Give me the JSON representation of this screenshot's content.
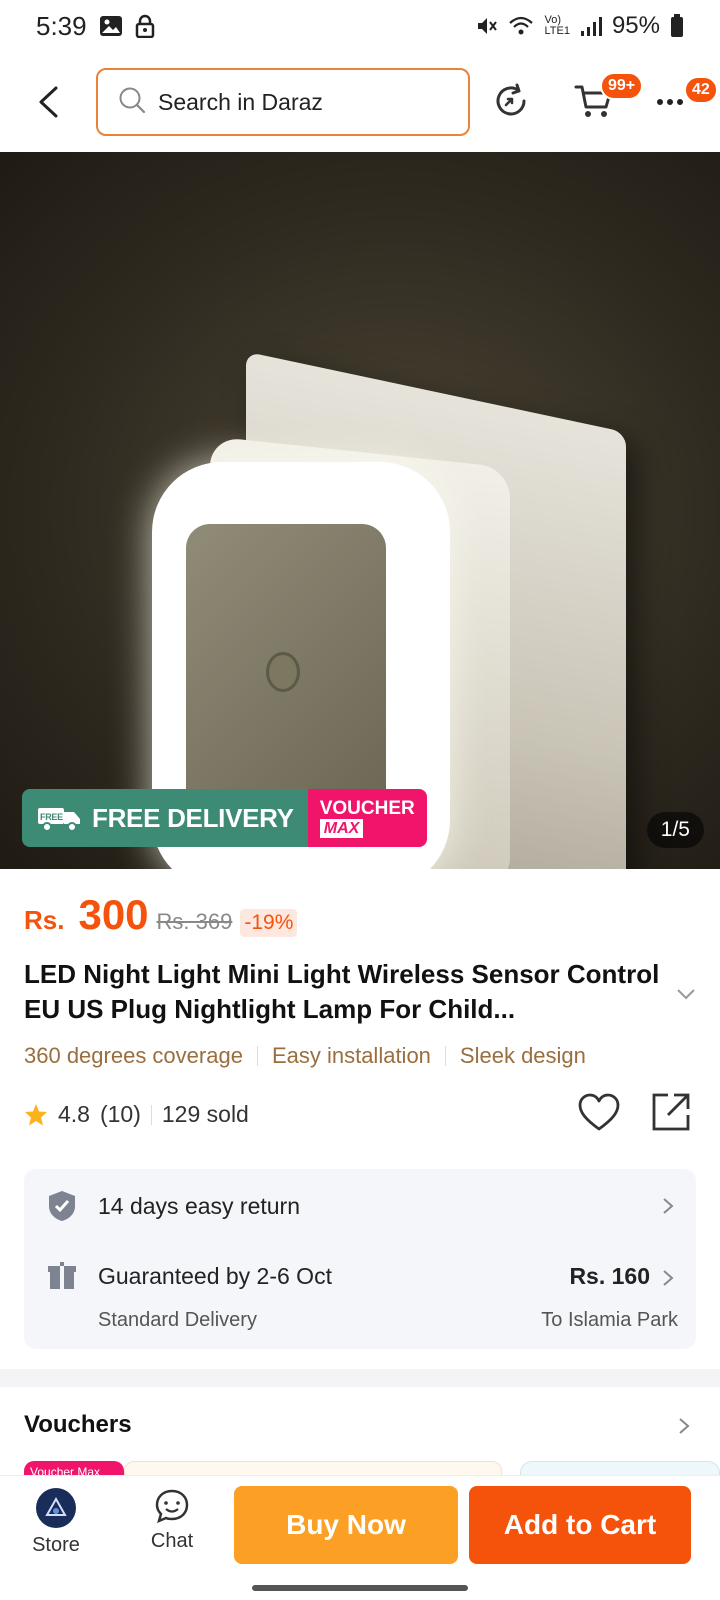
{
  "status_bar": {
    "time": "5:39",
    "battery": "95%"
  },
  "header": {
    "search_placeholder": "Search in Daraz",
    "cart_badge": "99+",
    "more_badge": "42"
  },
  "gallery": {
    "promo_free_tag": "FREE",
    "promo_free_label": "FREE DELIVERY",
    "promo_voucher_line1": "VOUCHER",
    "promo_voucher_line2": "MAX",
    "counter": "1/5"
  },
  "product": {
    "currency": "Rs.",
    "price": "300",
    "original_price": "Rs. 369",
    "discount": "-19%",
    "title": "LED Night Light Mini Light Wireless Sensor Control EU US Plug Nightlight Lamp For Child...",
    "features": [
      "360 degrees coverage",
      "Easy installation",
      "Sleek design"
    ],
    "rating": "4.8",
    "rating_count": "(10)",
    "sold": "129 sold"
  },
  "delivery": {
    "return_policy": "14 days easy return",
    "guarantee": "Guaranteed by 2-6 Oct",
    "method": "Standard Delivery",
    "fee": "Rs. 160",
    "location": "To Islamia Park"
  },
  "vouchers": {
    "title": "Vouchers",
    "peek_label": "Voucher Max"
  },
  "bottom_bar": {
    "store_label": "Store",
    "chat_label": "Chat",
    "buy_now": "Buy Now",
    "add_to_cart": "Add to Cart"
  },
  "colors": {
    "accent": "#f5520c",
    "buy_now": "#fba025",
    "feature_text": "#9a6e3e"
  }
}
